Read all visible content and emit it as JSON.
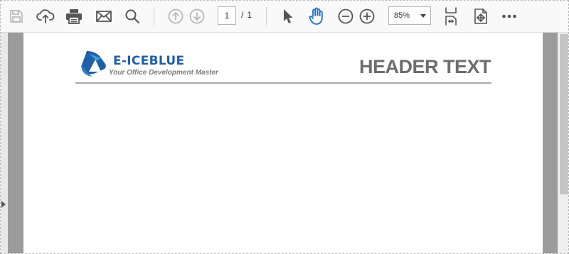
{
  "toolbar": {
    "buttons": [
      {
        "name": "save",
        "icon": "save-icon",
        "enabled": false
      },
      {
        "name": "upload",
        "icon": "upload-cloud-icon",
        "enabled": true
      },
      {
        "name": "print",
        "icon": "print-icon",
        "enabled": true
      },
      {
        "name": "email",
        "icon": "mail-icon",
        "enabled": true
      },
      {
        "name": "search",
        "icon": "search-icon",
        "enabled": true
      },
      {
        "name": "previous-page",
        "icon": "arrow-up-circle-icon",
        "enabled": false
      },
      {
        "name": "next-page",
        "icon": "arrow-down-circle-icon",
        "enabled": false
      },
      {
        "name": "select-tool",
        "icon": "cursor-arrow-icon",
        "enabled": true
      },
      {
        "name": "hand-tool",
        "icon": "hand-icon",
        "enabled": true,
        "active": true
      },
      {
        "name": "zoom-out",
        "icon": "minus-circle-icon",
        "enabled": true
      },
      {
        "name": "zoom-in",
        "icon": "plus-circle-icon",
        "enabled": true
      },
      {
        "name": "fit-page",
        "icon": "fit-page-icon",
        "enabled": true
      },
      {
        "name": "fit-width",
        "icon": "fit-width-icon",
        "enabled": true
      },
      {
        "name": "more",
        "icon": "more-horizontal-icon",
        "enabled": true
      }
    ],
    "page_number": "1",
    "page_separator": "/",
    "page_count": "1",
    "zoom_value": "85%"
  },
  "document": {
    "brand_name": "E-ICEBLUE",
    "brand_tagline": "Your Office Development Master",
    "header_text": "HEADER TEXT"
  },
  "colors": {
    "accent": "#1a73c4",
    "icon": "#555555",
    "icon_disabled": "#b5b5b5",
    "brand": "#1f5fa8",
    "header_text": "#6d6d6d",
    "gutter": "#9b9b9b"
  }
}
